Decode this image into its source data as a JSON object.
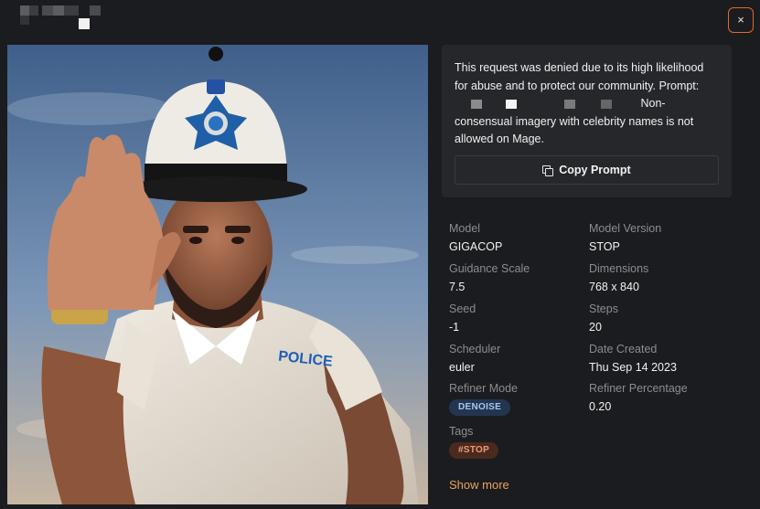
{
  "header": {
    "close_label": "×"
  },
  "prompt_card": {
    "text_before": "This request was denied due to its high likelihood for abuse and to protect our community. Prompt:",
    "text_after": "Non-consensual imagery with celebrity names is not allowed on Mage.",
    "copy_label": "Copy Prompt"
  },
  "details": {
    "model_label": "Model",
    "model_value": "GIGACOP",
    "model_version_label": "Model Version",
    "model_version_value": "STOP",
    "guidance_label": "Guidance Scale",
    "guidance_value": "7.5",
    "dimensions_label": "Dimensions",
    "dimensions_value": "768 x 840",
    "seed_label": "Seed",
    "seed_value": "-1",
    "steps_label": "Steps",
    "steps_value": "20",
    "scheduler_label": "Scheduler",
    "scheduler_value": "euler",
    "date_label": "Date Created",
    "date_value": "Thu Sep 14 2023",
    "refiner_mode_label": "Refiner Mode",
    "refiner_mode_value": "DENOISE",
    "refiner_pct_label": "Refiner Percentage",
    "refiner_pct_value": "0.20",
    "tags_label": "Tags",
    "tag_1": "#STOP"
  },
  "image": {
    "uniform_text": "POLICE"
  },
  "show_more_label": "Show more",
  "colors": {
    "background": "#1b1c1f",
    "card": "#26272b",
    "accent_orange": "#e8a35f",
    "close_border": "#e06a2c"
  }
}
